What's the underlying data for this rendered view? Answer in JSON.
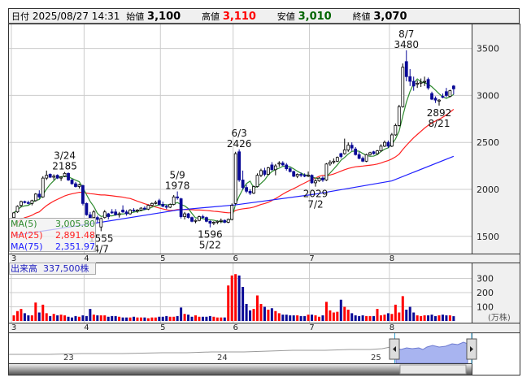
{
  "header": {
    "date_label": "日付",
    "date": "2025/08/27 14:31",
    "open_label": "始値",
    "open": "3,100",
    "high_label": "高値",
    "high": "3,110",
    "low_label": "安値",
    "low": "3,010",
    "close_label": "終値",
    "close": "3,070"
  },
  "legend": {
    "ma5_label": "MA(5)",
    "ma5": "3,005.80",
    "ma25_label": "MA(25)",
    "ma25": "2,891.48",
    "ma75_label": "MA(75)",
    "ma75": "2,351.97"
  },
  "volume_label": "出来高",
  "volume_value": "337,500株",
  "colors": {
    "up_candle": "#ffffff",
    "down_candle": "#0a0a96",
    "ma5": "#2e8b2e",
    "ma25": "#ff2020",
    "ma75": "#2020ff",
    "vol_up": "#ff0000",
    "vol_down": "#0a0a96",
    "nav_fill": "#a8b4f0"
  },
  "chart_data": {
    "type": "candlestick",
    "price_axis": {
      "ticks": [
        "3500",
        "3000",
        "2500",
        "2000",
        "1500"
      ],
      "tick_values": [
        3500,
        3000,
        2500,
        2000,
        1500
      ]
    },
    "month_ticks": [
      {
        "label": "3",
        "index": 0
      },
      {
        "label": "4",
        "index": 20
      },
      {
        "label": "5",
        "index": 41
      },
      {
        "label": "6",
        "index": 61
      },
      {
        "label": "7",
        "index": 82
      },
      {
        "label": "8",
        "index": 104
      }
    ],
    "volume_axis": {
      "ticks": [
        "300",
        "200",
        "100"
      ],
      "tick_values": [
        300,
        200,
        100
      ],
      "unit": "(万株)"
    },
    "ohlc": [
      [
        1700,
        1760,
        1690,
        1750
      ],
      [
        1760,
        1830,
        1750,
        1820
      ],
      [
        1830,
        1880,
        1810,
        1870
      ],
      [
        1870,
        1880,
        1850,
        1860
      ],
      [
        1860,
        1880,
        1840,
        1850
      ],
      [
        1850,
        1890,
        1830,
        1880
      ],
      [
        1880,
        1960,
        1870,
        1950
      ],
      [
        1950,
        1990,
        1900,
        1920
      ],
      [
        1920,
        2140,
        1910,
        2120
      ],
      [
        2120,
        2200,
        2100,
        2150
      ],
      [
        2160,
        2170,
        2120,
        2130
      ],
      [
        2130,
        2160,
        2100,
        2140
      ],
      [
        2150,
        2160,
        2110,
        2120
      ],
      [
        2120,
        2140,
        2090,
        2130
      ],
      [
        2140,
        2185,
        2130,
        2170
      ],
      [
        2170,
        2180,
        2090,
        2100
      ],
      [
        2100,
        2110,
        2050,
        2060
      ],
      [
        2060,
        2080,
        2020,
        2030
      ],
      [
        2030,
        2060,
        2010,
        2050
      ],
      [
        2040,
        2050,
        1830,
        1850
      ],
      [
        1850,
        1860,
        1720,
        1730
      ],
      [
        1730,
        1760,
        1690,
        1700
      ],
      [
        1700,
        1780,
        1680,
        1760
      ],
      [
        1700,
        1720,
        1650,
        1680
      ],
      [
        1600,
        1700,
        1555,
        1690
      ],
      [
        1700,
        1780,
        1690,
        1760
      ],
      [
        1740,
        1750,
        1680,
        1710
      ],
      [
        1760,
        1790,
        1740,
        1750
      ],
      [
        1760,
        1790,
        1720,
        1730
      ],
      [
        1730,
        1760,
        1700,
        1740
      ],
      [
        1780,
        1830,
        1750,
        1760
      ],
      [
        1760,
        1780,
        1720,
        1740
      ],
      [
        1740,
        1790,
        1730,
        1780
      ],
      [
        1780,
        1800,
        1760,
        1770
      ],
      [
        1770,
        1790,
        1750,
        1780
      ],
      [
        1780,
        1810,
        1770,
        1800
      ],
      [
        1800,
        1820,
        1780,
        1790
      ],
      [
        1790,
        1840,
        1780,
        1830
      ],
      [
        1830,
        1860,
        1820,
        1850
      ],
      [
        1850,
        1880,
        1840,
        1860
      ],
      [
        1880,
        1900,
        1830,
        1840
      ],
      [
        1840,
        1870,
        1810,
        1820
      ],
      [
        1820,
        1840,
        1790,
        1810
      ],
      [
        1810,
        1850,
        1800,
        1840
      ],
      [
        1840,
        1940,
        1830,
        1920
      ],
      [
        1920,
        1978,
        1890,
        1910
      ],
      [
        1900,
        1910,
        1690,
        1710
      ],
      [
        1710,
        1760,
        1680,
        1740
      ],
      [
        1740,
        1750,
        1690,
        1700
      ],
      [
        1700,
        1710,
        1650,
        1660
      ],
      [
        1660,
        1680,
        1640,
        1670
      ],
      [
        1670,
        1720,
        1660,
        1710
      ],
      [
        1710,
        1730,
        1690,
        1700
      ],
      [
        1700,
        1710,
        1650,
        1660
      ],
      [
        1660,
        1670,
        1596,
        1640
      ],
      [
        1640,
        1660,
        1620,
        1650
      ],
      [
        1650,
        1670,
        1630,
        1660
      ],
      [
        1660,
        1690,
        1640,
        1670
      ],
      [
        1670,
        1680,
        1640,
        1650
      ],
      [
        1650,
        1690,
        1640,
        1680
      ],
      [
        1680,
        1850,
        1670,
        1830
      ],
      [
        1850,
        2400,
        1840,
        2380
      ],
      [
        2400,
        2426,
        2080,
        2100
      ],
      [
        2100,
        2200,
        2000,
        2020
      ],
      [
        2020,
        2050,
        1960,
        1980
      ],
      [
        1980,
        2000,
        1940,
        1960
      ],
      [
        1960,
        2040,
        1950,
        2030
      ],
      [
        2030,
        2170,
        2020,
        2150
      ],
      [
        2150,
        2220,
        2130,
        2200
      ],
      [
        2200,
        2230,
        2140,
        2160
      ],
      [
        2160,
        2240,
        2150,
        2230
      ],
      [
        2260,
        2290,
        2200,
        2210
      ],
      [
        2210,
        2270,
        2150,
        2250
      ],
      [
        2270,
        2300,
        2240,
        2280
      ],
      [
        2280,
        2300,
        2250,
        2260
      ],
      [
        2260,
        2280,
        2200,
        2220
      ],
      [
        2220,
        2240,
        2180,
        2190
      ],
      [
        2190,
        2200,
        2130,
        2140
      ],
      [
        2140,
        2170,
        2120,
        2160
      ],
      [
        2160,
        2180,
        2130,
        2150
      ],
      [
        2150,
        2170,
        2130,
        2140
      ],
      [
        2140,
        2190,
        2130,
        2150
      ],
      [
        2150,
        2160,
        2060,
        2070
      ],
      [
        2070,
        2110,
        2029,
        2090
      ],
      [
        2090,
        2130,
        2080,
        2120
      ],
      [
        2120,
        2140,
        2080,
        2100
      ],
      [
        2100,
        2280,
        2090,
        2270
      ],
      [
        2270,
        2310,
        2250,
        2290
      ],
      [
        2290,
        2330,
        2270,
        2300
      ],
      [
        2300,
        2350,
        2290,
        2340
      ],
      [
        2380,
        2390,
        2330,
        2350
      ],
      [
        2380,
        2540,
        2370,
        2420
      ],
      [
        2420,
        2500,
        2400,
        2470
      ],
      [
        2470,
        2500,
        2410,
        2440
      ],
      [
        2430,
        2450,
        2360,
        2370
      ],
      [
        2370,
        2400,
        2320,
        2330
      ],
      [
        2330,
        2350,
        2290,
        2300
      ],
      [
        2300,
        2380,
        2290,
        2370
      ],
      [
        2370,
        2400,
        2360,
        2390
      ],
      [
        2400,
        2410,
        2370,
        2380
      ],
      [
        2380,
        2420,
        2370,
        2410
      ],
      [
        2410,
        2480,
        2400,
        2460
      ],
      [
        2460,
        2520,
        2450,
        2500
      ],
      [
        2500,
        2520,
        2440,
        2460
      ],
      [
        2460,
        2600,
        2450,
        2580
      ],
      [
        2580,
        2700,
        2570,
        2680
      ],
      [
        2680,
        2900,
        2670,
        2880
      ],
      [
        2880,
        3340,
        2870,
        3300
      ],
      [
        3360,
        3480,
        3150,
        3200
      ],
      [
        3200,
        3280,
        3100,
        3150
      ],
      [
        3150,
        3200,
        3050,
        3100
      ],
      [
        3120,
        3160,
        3080,
        3130
      ],
      [
        3130,
        3180,
        3090,
        3140
      ],
      [
        3150,
        3200,
        3100,
        3150
      ],
      [
        3170,
        3190,
        3060,
        3080
      ],
      [
        3020,
        3040,
        2950,
        2960
      ],
      [
        2970,
        2990,
        2920,
        2950
      ],
      [
        2940,
        2960,
        2892,
        2950
      ],
      [
        2990,
        3020,
        2970,
        2980
      ],
      [
        3040,
        3080,
        2980,
        3000
      ],
      [
        2990,
        3060,
        2980,
        3050
      ],
      [
        3100,
        3110,
        3010,
        3070
      ]
    ],
    "volume": [
      40,
      70,
      85,
      55,
      40,
      40,
      130,
      60,
      115,
      55,
      35,
      50,
      40,
      45,
      40,
      30,
      25,
      35,
      30,
      40,
      35,
      85,
      45,
      40,
      40,
      40,
      30,
      35,
      35,
      30,
      25,
      25,
      25,
      30,
      25,
      25,
      25,
      20,
      25,
      25,
      30,
      30,
      35,
      30,
      30,
      35,
      95,
      50,
      45,
      30,
      40,
      30,
      30,
      30,
      35,
      30,
      25,
      25,
      25,
      250,
      320,
      330,
      320,
      240,
      120,
      75,
      85,
      180,
      120,
      100,
      80,
      90,
      70,
      55,
      45,
      45,
      40,
      40,
      40,
      35,
      35,
      45,
      45,
      40,
      30,
      40,
      135,
      75,
      60,
      65,
      150,
      100,
      80,
      55,
      40,
      35,
      40,
      35,
      35,
      35,
      85,
      40,
      45,
      55,
      50,
      115,
      60,
      175,
      80,
      100,
      60,
      40,
      35,
      40,
      40,
      45,
      35,
      40,
      45,
      40,
      40,
      34
    ],
    "ma75_points": [
      [
        0,
        1510
      ],
      [
        24,
        1650
      ],
      [
        45,
        1780
      ],
      [
        61,
        1835
      ],
      [
        83,
        1950
      ],
      [
        104,
        2090
      ],
      [
        121,
        2352
      ]
    ],
    "annotations": [
      {
        "index": 14,
        "date": "3/24",
        "price": "2185",
        "pos": "above"
      },
      {
        "index": 24,
        "date": "4/7",
        "price": "1555",
        "pos": "below"
      },
      {
        "index": 45,
        "date": "5/9",
        "price": "1978",
        "pos": "above"
      },
      {
        "index": 54,
        "date": "5/22",
        "price": "1596",
        "pos": "below"
      },
      {
        "index": 62,
        "date": "6/3",
        "price": "2426",
        "pos": "above"
      },
      {
        "index": 83,
        "date": "7/2",
        "price": "2029",
        "pos": "below"
      },
      {
        "index": 108,
        "date": "8/7",
        "price": "3480",
        "pos": "above"
      },
      {
        "index": 117,
        "date": "8/21",
        "price": "2892",
        "pos": "below"
      }
    ],
    "navigator": {
      "year_labels": [
        "23",
        "24",
        "25"
      ]
    }
  }
}
